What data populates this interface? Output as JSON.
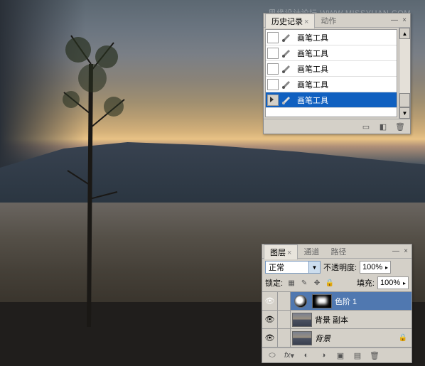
{
  "watermark": "思缘设计论坛 WWW.MISSYUAN.COM",
  "history": {
    "tabs": [
      "历史记录",
      "动作"
    ],
    "active_tab": 0,
    "items": [
      {
        "label": "画笔工具",
        "selected": false
      },
      {
        "label": "画笔工具",
        "selected": false
      },
      {
        "label": "画笔工具",
        "selected": false
      },
      {
        "label": "画笔工具",
        "selected": false
      },
      {
        "label": "画笔工具",
        "selected": true
      }
    ]
  },
  "layers": {
    "tabs": [
      "图层",
      "通道",
      "路径"
    ],
    "active_tab": 0,
    "blend_mode": "正常",
    "opacity_label": "不透明度:",
    "opacity_value": "100%",
    "lock_label": "锁定:",
    "fill_label": "填充:",
    "fill_value": "100%",
    "items": [
      {
        "name": "色阶 1",
        "type": "adjustment",
        "visible": true,
        "selected": true
      },
      {
        "name": "背景 副本",
        "type": "image",
        "visible": true,
        "selected": false
      },
      {
        "name": "背景",
        "type": "background",
        "visible": true,
        "selected": false,
        "italic": true
      }
    ]
  }
}
